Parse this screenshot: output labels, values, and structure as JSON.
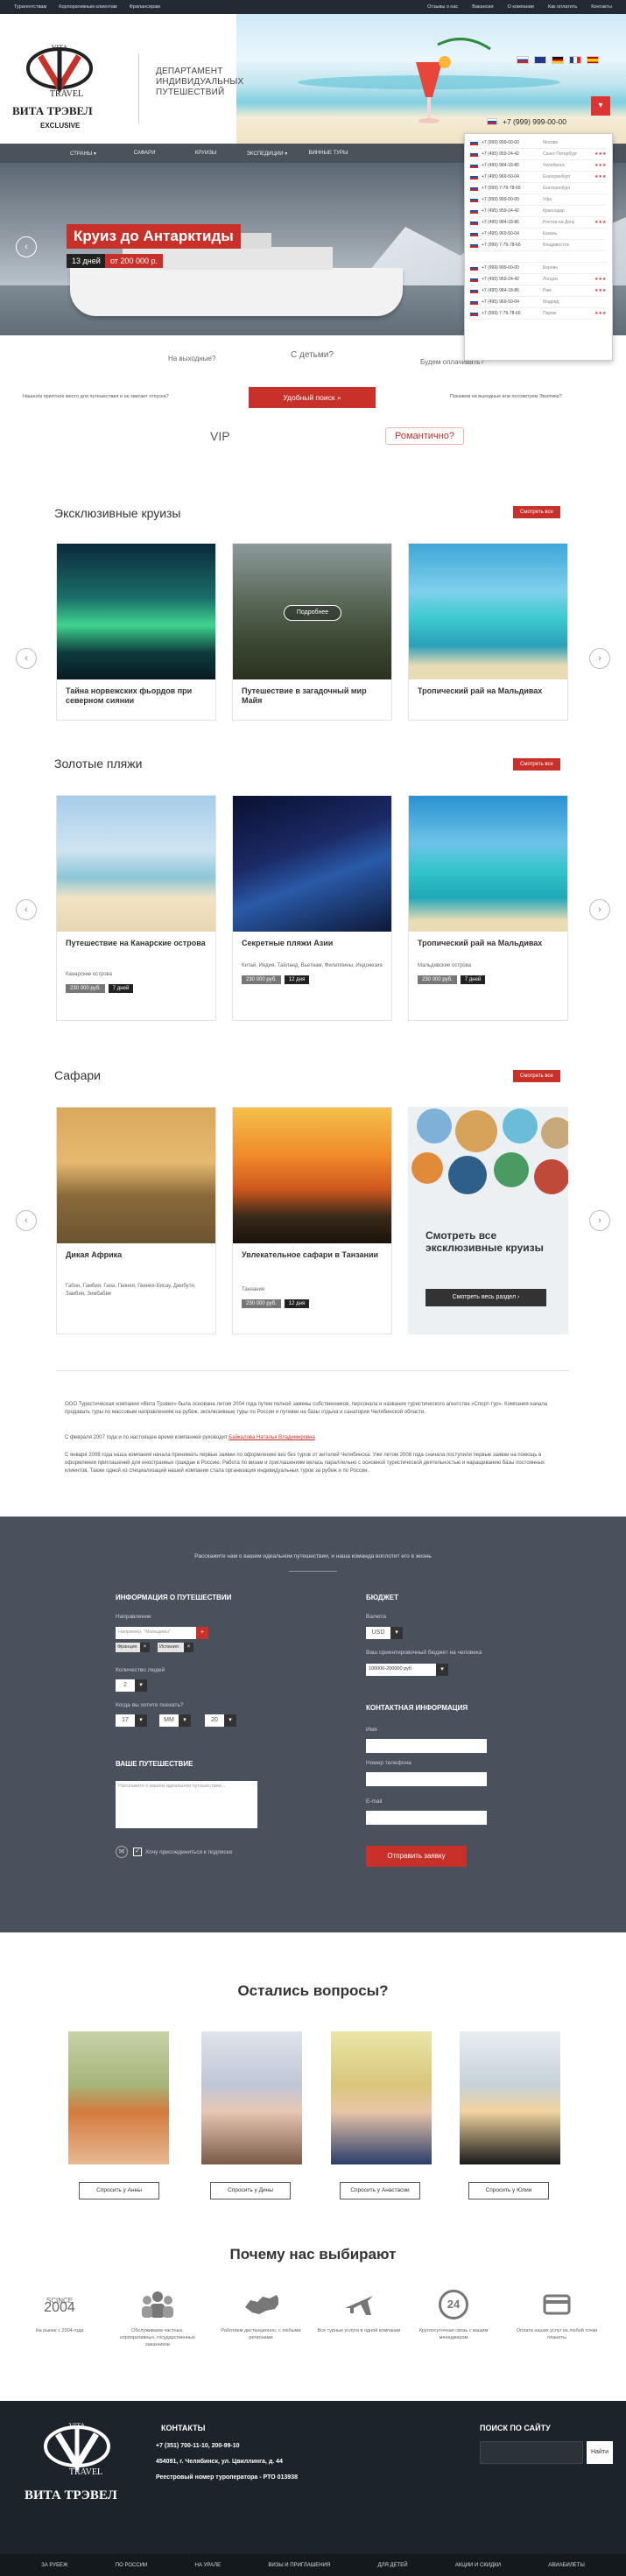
{
  "topbar": {
    "left": [
      "Турагентствам",
      "Корпоративным клиентам",
      "Фрилансерам"
    ],
    "right": [
      "Отзывы о нас",
      "Вакансии",
      "О компании",
      "Как оплатить",
      "Контакты"
    ]
  },
  "header": {
    "logo_top": "VITA",
    "logo_mid": "TRAVEL",
    "logo_name": "ВИТА ТРЭВЕЛ",
    "logo_sub": "EXCLUSIVE",
    "dept_line1": "ДЕПАРТАМЕНТ",
    "dept_line2": "ИНДИВИДУАЛЬНЫХ",
    "dept_line3": "ПУТЕШЕСТВИЙ",
    "phone": "+7 (999) 999-00-00"
  },
  "nav": [
    "СТРАНЫ ▾",
    "САФАРИ",
    "КРУИЗЫ",
    "ЭКСПЕДИЦИИ ▾",
    "ВИННЫЕ ТУРЫ",
    "",
    "",
    ""
  ],
  "hero": {
    "title": "Круиз до Антарктиды",
    "days": "13 дней",
    "price": "от 200 000 р."
  },
  "phones": [
    {
      "num": "+7 (999) 999-00-00",
      "city": "Москва",
      "stars": ""
    },
    {
      "num": "+7 (495) 959-24-42",
      "city": "Санкт-Петербург",
      "stars": "★★★"
    },
    {
      "num": "+7 (495) 984-18-86",
      "city": "Челябинск",
      "stars": "★★★"
    },
    {
      "num": "+7 (495) 969-50-04",
      "city": "Екатеринбург",
      "stars": "★★★"
    },
    {
      "num": "+7 (999) 7-79-78-66",
      "city": "Екатеринбург",
      "stars": ""
    },
    {
      "num": "+7 (999) 999-00-00",
      "city": "Уфа",
      "stars": ""
    },
    {
      "num": "+7 (495) 959-24-42",
      "city": "Краснодар",
      "stars": ""
    },
    {
      "num": "+7 (495) 984-18-86",
      "city": "Ростов-на-Дону",
      "stars": "★★★"
    },
    {
      "num": "+7 (495) 969-50-04",
      "city": "Казань",
      "stars": ""
    },
    {
      "num": "+7 (999) 7-79-78-66",
      "city": "Владивосток",
      "stars": ""
    },
    {
      "num": "",
      "city": "",
      "stars": ""
    },
    {
      "num": "+7 (999) 999-00-00",
      "city": "Берлин",
      "stars": ""
    },
    {
      "num": "+7 (495) 959-24-42",
      "city": "Лондон",
      "stars": "★★★"
    },
    {
      "num": "+7 (495) 984-18-86",
      "city": "Рим",
      "stars": "★★★"
    },
    {
      "num": "+7 (495) 969-50-04",
      "city": "Мадрид",
      "stars": ""
    },
    {
      "num": "+7 (999) 7-79-78-66",
      "city": "Париж",
      "stars": "★★★"
    }
  ],
  "quick": {
    "weekend": "На выходные?",
    "kids": "С детьми?",
    "unusual": "Будем оплачивать?",
    "left_small": "Нашел/а приятное место для путешествия и не хватает отпуска?",
    "right_small": "Покажем на выходные или посоветуем Экзотики?",
    "search": "Удобный поиск",
    "vip": "VIP",
    "romantic": "Романтично?"
  },
  "cruises": {
    "title": "Эксклюзивные круизы",
    "btn": "Смотреть все",
    "items": [
      {
        "name": "Тайна норвежских фьордов при северном сиянии"
      },
      {
        "name": "Путешествие в загадочный мир Майя",
        "overlay": "Подробнее"
      },
      {
        "name": "Тропический рай на Мальдивах"
      }
    ]
  },
  "beaches": {
    "title": "Золотые пляжи",
    "btn": "Смотреть все",
    "items": [
      {
        "name": "Путешествие на Канарские острова",
        "sub": "Канарские острова",
        "price": "230 000 руб.",
        "days": "7 дней"
      },
      {
        "name": "Секретные пляжи Азии",
        "sub": "Китай, Индия, Тайланд, Вьетнам, Филиппины, Индонезия",
        "price": "230 000 руб.",
        "days": "12 дня"
      },
      {
        "name": "Тропический рай на Мальдивах",
        "sub": "Мальдивские острова",
        "price": "230 000 руб.",
        "days": "7 дней"
      }
    ]
  },
  "safari": {
    "title": "Сафари",
    "btn": "Смотреть все",
    "items": [
      {
        "name": "Дикая Африка",
        "sub": "Габон, Гамбия, Гана, Гвинея, Гвинея-Бисау, Джибути, Замбия, Зимбабве",
        "price": "",
        "days": ""
      },
      {
        "name": "Увлекательное сафари в Танзании",
        "sub": "Танзания",
        "price": "230 000 руб.",
        "days": "12 дня"
      }
    ],
    "all_title": "Смотреть все эксклюзивные круизы",
    "all_btn": "Смотреть весь раздел"
  },
  "info": {
    "p1": "ООО Туристическая компания «Вита Трэвел» была основана летом 2004 года путем полной замены собственников, персонала и названия туристического агентства «Спорт-тур». Компания начала продавать туры по массовым направлениям на рубеж, эксклюзивные туры по России и путевки на базы отдыха и санатории Челябинской области.",
    "p2": "С февраля 2007 года и по настоящее время компанией руководит",
    "p2_link": "Байкалова Наталья Владимировна",
    "p3": "С января 2008 года наша компания начала принимать первые заявки по оформлению виз без туров от жителей Челябинска. Уже летом 2008 года сначала поступили первые заявки на помощь в оформлении приглашений для иностранных граждан в Россию. Работа по визам и приглашениям велась параллельно с основной туристической деятельностью и наращиванию базы постоянных клиентов. Также одной из специализаций нашей компании стала организация индивидуальных туров за рубеж и по России."
  },
  "form": {
    "intro": "Расскажите нам о вашем идеальном путешествии, и наша команда воплотит его в жизнь",
    "info_title": "ИНФОРМАЦИЯ О ПУТЕШЕСТВИИ",
    "direction_label": "Направление",
    "direction_placeholder": "Например: \"Мальдивы\"",
    "country1": "Франция",
    "country2": "Испания",
    "people_label": "Количество людей",
    "people_value": "2",
    "dates_label": "Когда вы хотите поехать?",
    "day": "17",
    "month": "MM",
    "year": "20",
    "trip_title": "ВАШЕ ПУТЕШЕСТВИЕ",
    "trip_placeholder": "Расскажите о вашем идеальном путешествии...",
    "consent": "Хочу присоединиться к подписке",
    "budget_title": "БЮДЖЕТ",
    "currency_label": "Валюта",
    "currency": "USD",
    "budget_label": "Ваш ориентировочный бюджет на человека",
    "budget_value": "100000-200000 руб",
    "contact_title": "КОНТАКТНАЯ ИНФОРМАЦИЯ",
    "name_label": "Имя",
    "phone_label": "Номер телефона",
    "email_label": "E-mail",
    "submit": "Отправить заявку"
  },
  "questions": {
    "title": "Остались вопросы?",
    "buttons": [
      "Спросить у Анны",
      "Спросить у Дины",
      "Спросить у Анастасии",
      "Спросить у Юлии"
    ]
  },
  "why": {
    "title": "Почему нас выбирают",
    "year_top": "SCINCE",
    "year": "2004",
    "big_24": "24",
    "items": [
      "На рынке с 2004 года",
      "Обслуживаем частных, корпоративных, государственных заказчиков",
      "Работаем дистанционно, с любыми регионами",
      "Все турные услуги в одной компании",
      "Круглосуточная связь с вашим менеджером",
      "Оплата наших услуг из любой точки планеты"
    ]
  },
  "footer": {
    "logo_top": "VITA",
    "logo_mid": "TRAVEL",
    "logo_name": "ВИТА ТРЭВЕЛ",
    "contacts_title": "КОНТАКТЫ",
    "phone": "+7 (351) 700-11-10, 200-99-10",
    "address": "454091, г. Челябинск, ул. Цвиллинга, д. 44",
    "reg": "Реестровый номер туроператора - РТО 013938",
    "search_title": "ПОИСК ПО САЙТУ",
    "search_btn": "Найти",
    "bottom": [
      "ЗА РУБЕЖ",
      "ПО РОССИИ",
      "НА УРАЛЕ",
      "ВИЗЫ И ПРИГЛАШЕНИЯ",
      "ДЛЯ ДЕТЕЙ",
      "АКЦИИ И СКИДКИ",
      "АВИАБИЛЕТЫ"
    ]
  },
  "colors": {
    "accent": "#c8312a",
    "dark": "#222a33",
    "form_bg": "#4a515c"
  }
}
